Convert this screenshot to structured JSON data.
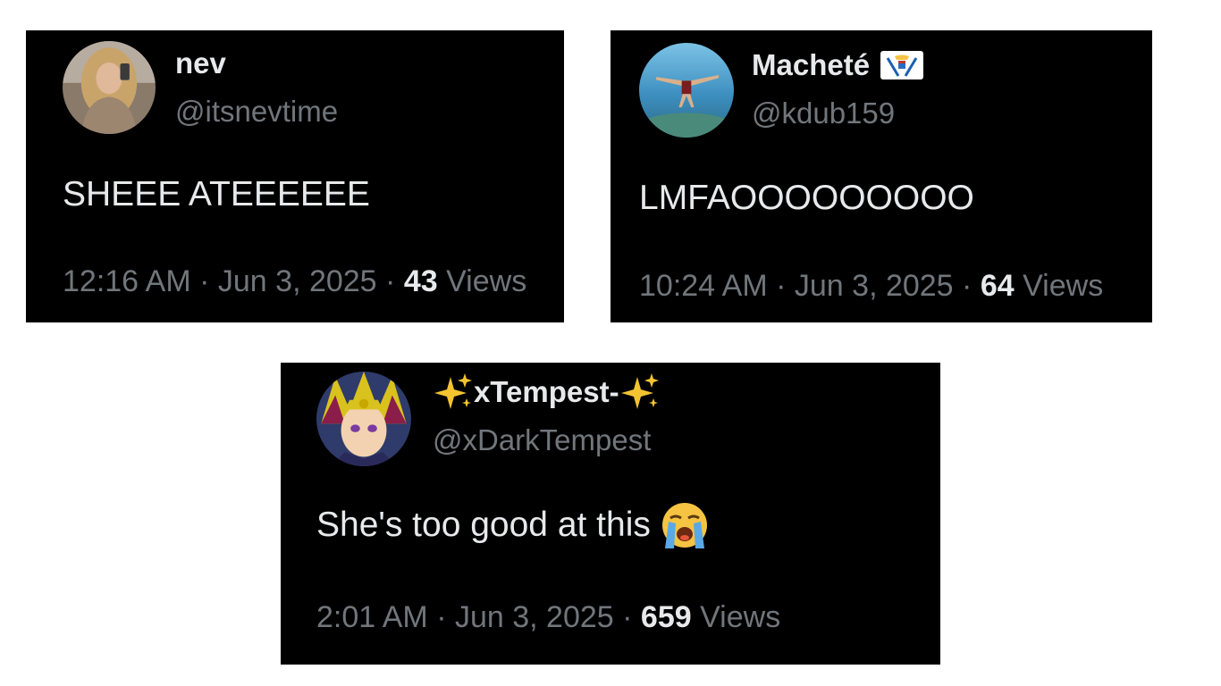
{
  "tweets": [
    {
      "display_name": "nev",
      "handle": "@itsnevtime",
      "text": "SHEEE ATEEEEEE",
      "time": "12:16 AM",
      "date": "Jun 3, 2025",
      "separator": "·",
      "views_count": "43",
      "views_label": "Views",
      "avatar_icon": "selfie-photo"
    },
    {
      "display_name": "Macheté",
      "handle": "@kdub159",
      "text": "LMFAOOOOOOOOO",
      "time": "10:24 AM",
      "date": "Jun 3, 2025",
      "separator": "·",
      "views_count": "64",
      "views_label": "Views",
      "avatar_icon": "diver-ocean-photo",
      "name_badge_icon": "us-virgin-islands-flag"
    },
    {
      "display_name": "xTempest-",
      "handle": "@xDarkTempest",
      "text": "She's too good at this",
      "time": "2:01 AM",
      "date": "Jun 3, 2025",
      "separator": "·",
      "views_count": "659",
      "views_label": "Views",
      "avatar_icon": "anime-character",
      "name_icons": [
        "sparkles-emoji",
        "sparkles-emoji"
      ],
      "text_emoji": "loudly-crying-face-emoji"
    }
  ],
  "colors": {
    "card_background": "#000000",
    "primary_text": "#e7e9ea",
    "secondary_text": "#71767b",
    "page_background": "#ffffff"
  }
}
